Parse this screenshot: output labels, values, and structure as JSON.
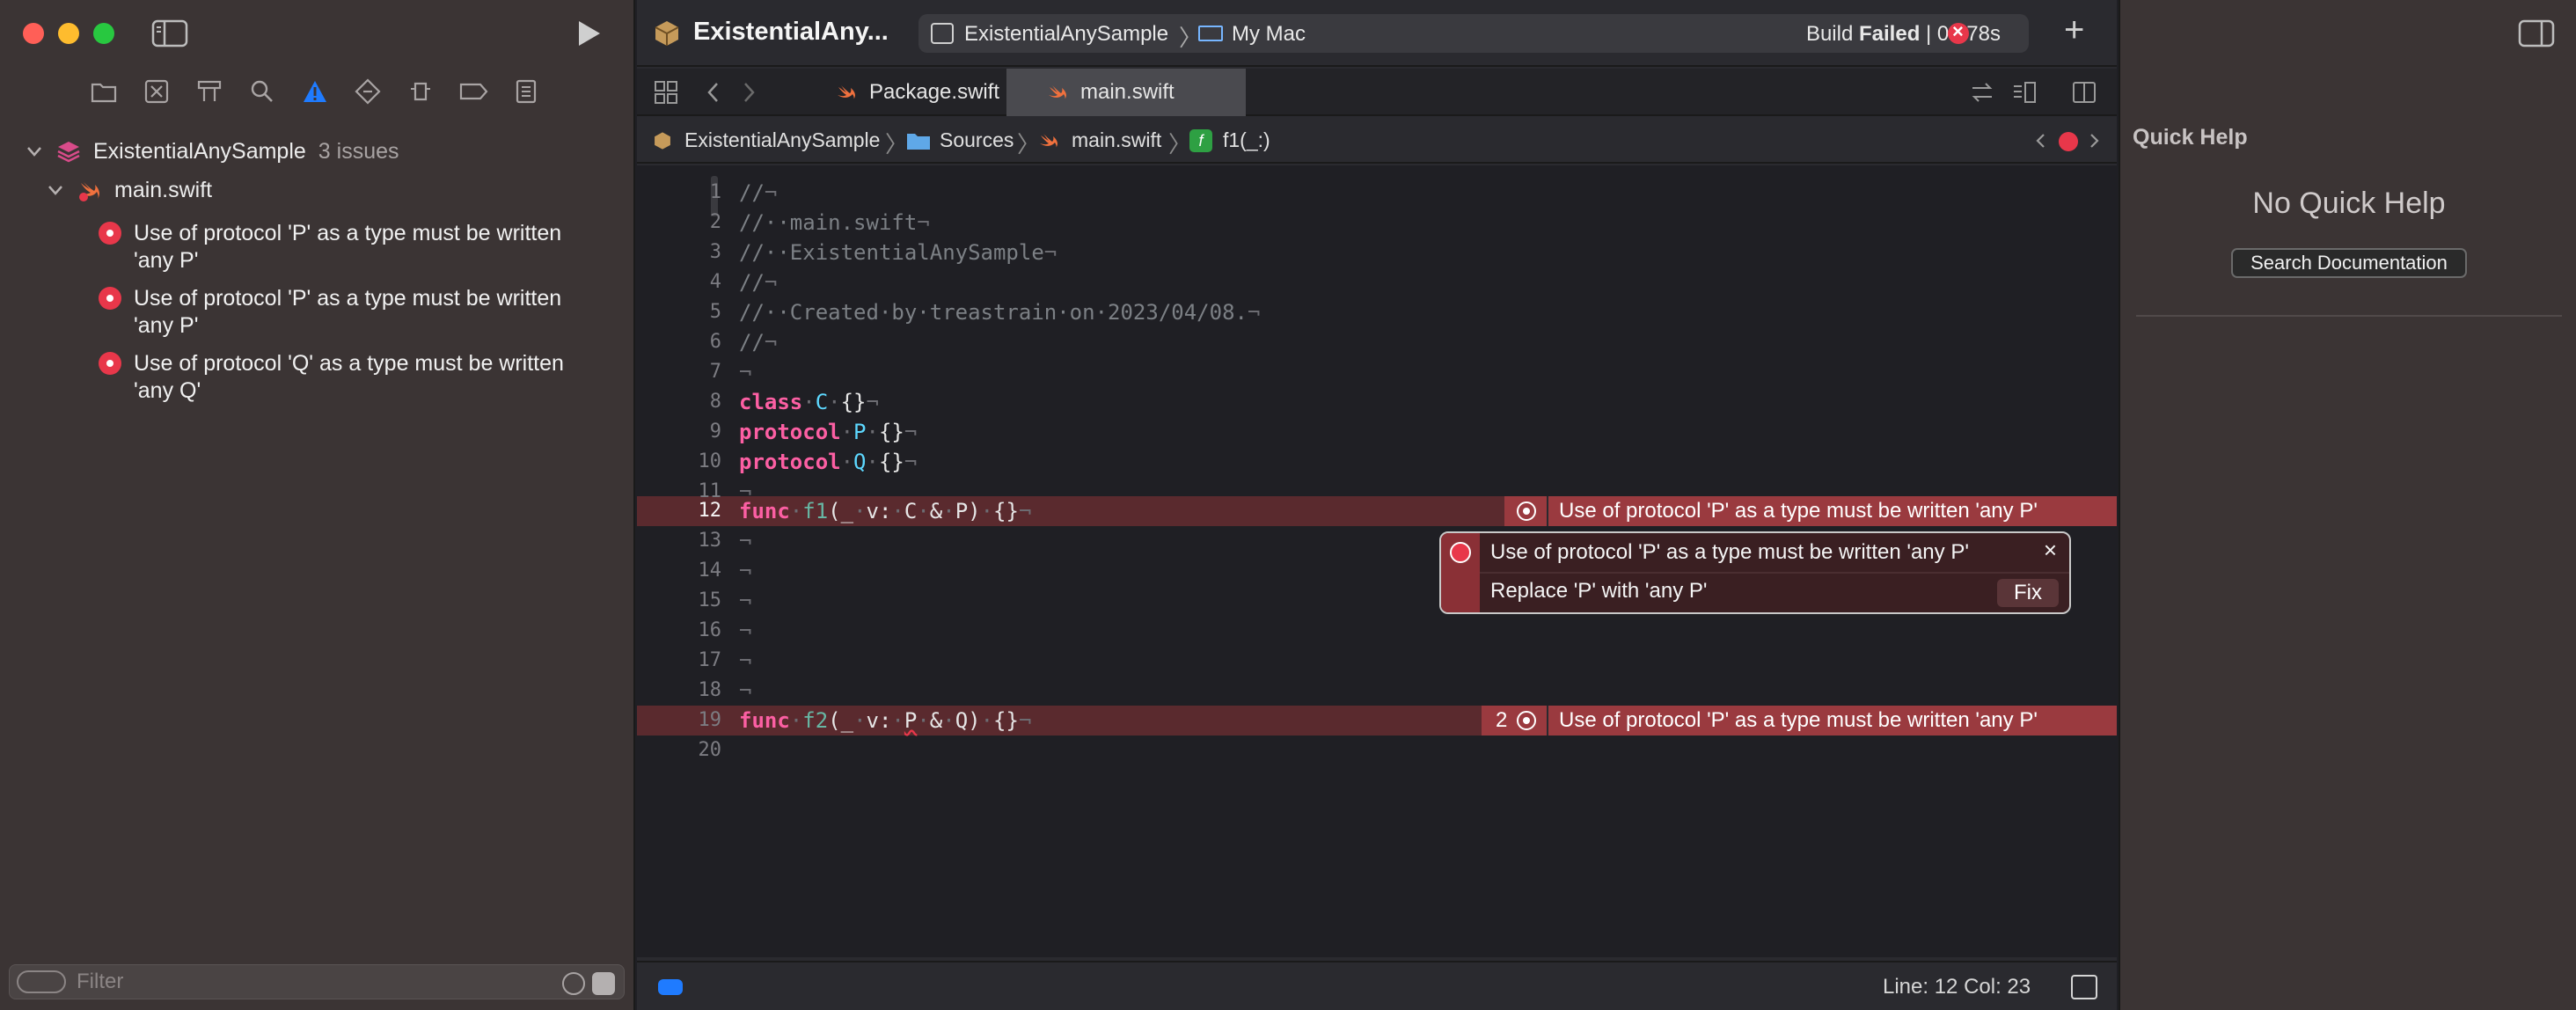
{
  "toolbar": {
    "project_title": "ExistentialAny...",
    "scheme": "ExistentialAnySample",
    "destination": "My Mac",
    "build_prefix": "Build ",
    "build_status": "Failed",
    "build_time": " | 0.178s"
  },
  "navigator": {
    "project": "ExistentialAnySample",
    "issue_count": "3 issues",
    "file": "main.swift",
    "issues": [
      "Use of protocol 'P' as a type must be written 'any P'",
      "Use of protocol 'P' as a type must be written 'any P'",
      "Use of protocol 'Q' as a type must be written 'any Q'"
    ],
    "filter_placeholder": "Filter"
  },
  "tabs": [
    "Package.swift",
    "main.swift"
  ],
  "jumpbar": {
    "project": "ExistentialAnySample",
    "folder": "Sources",
    "file": "main.swift",
    "symbol": "f1(_:)",
    "symbol_badge": "f"
  },
  "editor": {
    "line_numbers": [
      "1",
      "2",
      "3",
      "4",
      "5",
      "6",
      "7",
      "8",
      "9",
      "10",
      "11",
      "12",
      "13",
      "14",
      "15",
      "16",
      "17",
      "18",
      "19",
      "20"
    ],
    "active_line": "12",
    "inline_errors": [
      {
        "line": "12",
        "message": "Use of protocol 'P' as a type must be written 'any P'"
      },
      {
        "line": "19",
        "count": "2",
        "message": "Use of protocol 'P' as a type must be written 'any P'"
      }
    ],
    "fixit": {
      "message": "Use of protocol 'P' as a type must be written 'any P'",
      "suggestion": "Replace 'P' with 'any P'",
      "button": "Fix",
      "close": "×"
    }
  },
  "statusbar": {
    "position": "Line: 12  Col: 23"
  },
  "inspector": {
    "title": "Quick Help",
    "empty": "No Quick Help",
    "search_button": "Search Documentation"
  },
  "colors": {
    "error": "#e8374a",
    "keyword": "#fc5fa3",
    "type": "#5dd8ff",
    "accent": "#1f7bff"
  }
}
